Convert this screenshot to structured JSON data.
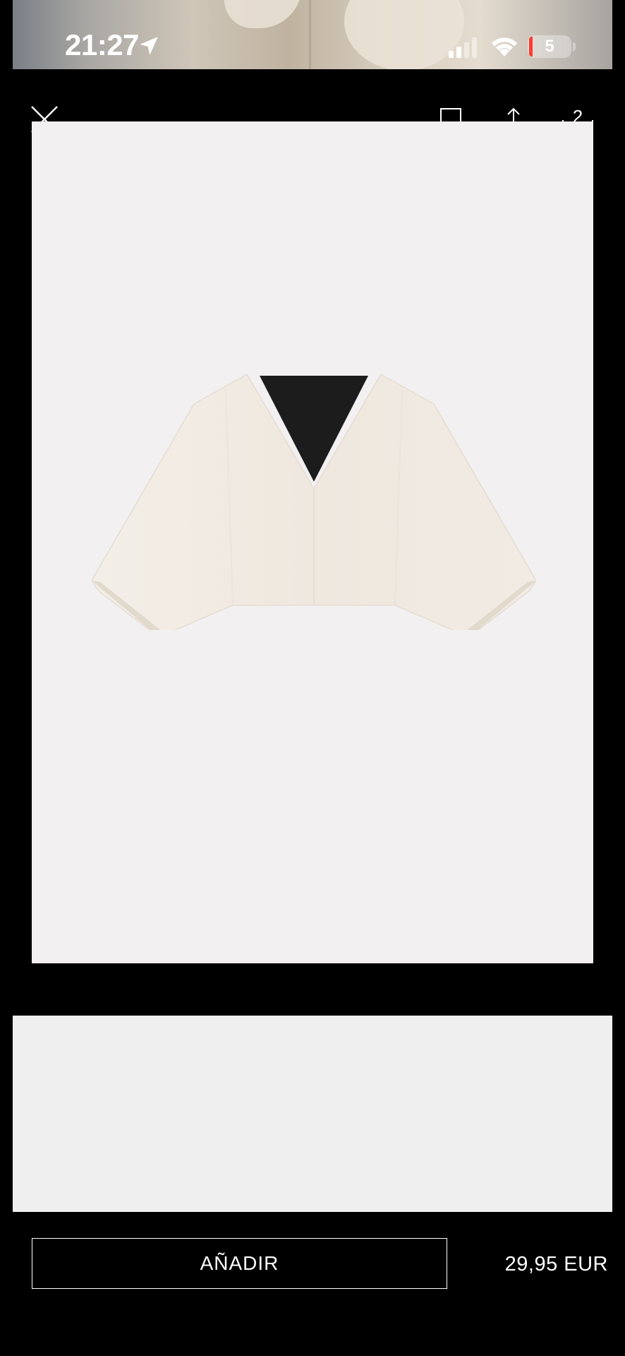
{
  "status_bar": {
    "time": "21:27",
    "battery_level": "5"
  },
  "header": {
    "cart_count": "2"
  },
  "icons": {
    "close": "close-icon",
    "bookmark": "bookmark-icon",
    "share": "share-icon",
    "cart": "bag-icon",
    "location": "location-arrow-icon",
    "signal": "cellular-signal-icon",
    "wifi": "wifi-icon"
  },
  "product": {
    "image_alt": "",
    "add_label": "AÑADIR",
    "price": "29,95 EUR"
  },
  "colors": {
    "background": "#000000",
    "card": "#f2f0f1",
    "garment": "#f1ebe3",
    "battery_low": "#ff3b30"
  }
}
